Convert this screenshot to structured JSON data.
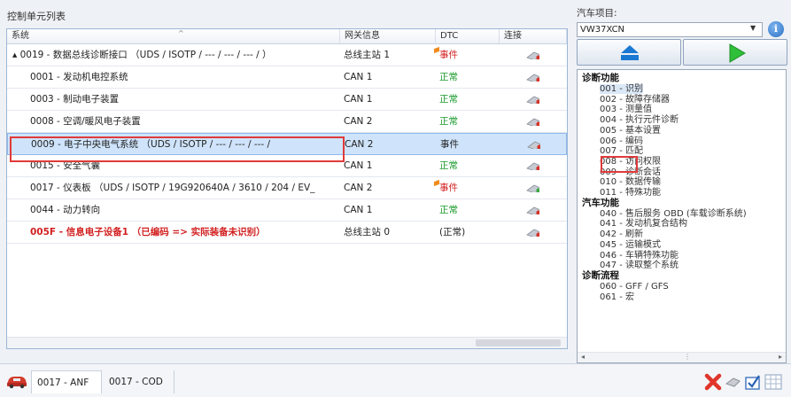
{
  "left_panel": {
    "title": "控制单元列表"
  },
  "table": {
    "headers": [
      "系统",
      "网关信息",
      "DTC",
      "连接"
    ],
    "rows": [
      {
        "system": "▴ 0019 - 数据总线诊断接口 （UDS / ISOTP / --- / --- / --- / ）",
        "gateway": "总线主站 1",
        "dtc": "事件",
        "dtc_style": "red",
        "conn_icon": "plug-icon"
      },
      {
        "system": "0001 - 发动机电控系统",
        "gateway": "CAN 1",
        "dtc": "正常",
        "dtc_style": "green",
        "conn_icon": "plug-icon"
      },
      {
        "system": "0003 - 制动电子装置",
        "gateway": "CAN 1",
        "dtc": "正常",
        "dtc_style": "green",
        "conn_icon": "plug-icon"
      },
      {
        "system": "0008 - 空调/暖风电子装置",
        "gateway": "CAN 2",
        "dtc": "正常",
        "dtc_style": "green",
        "conn_icon": "plug-icon"
      },
      {
        "system": "0009 - 电子中央电气系统 （UDS / ISOTP / --- / --- / --- /",
        "gateway": "CAN 2",
        "dtc": "事件",
        "dtc_style": "normal",
        "conn_icon": "plug-icon",
        "selected": true
      },
      {
        "system": "0015 - 安全气囊",
        "gateway": "CAN 1",
        "dtc": "正常",
        "dtc_style": "green",
        "conn_icon": "plug-icon"
      },
      {
        "system": "0017 - 仪表板 （UDS / ISOTP / 19G920640A / 3610 / 204 / EV_",
        "gateway": "CAN 2",
        "dtc": "事件",
        "dtc_style": "red",
        "conn_icon": "plug-green-icon"
      },
      {
        "system": "0044 - 动力转向",
        "gateway": "CAN 1",
        "dtc": "正常",
        "dtc_style": "green",
        "conn_icon": "plug-icon"
      },
      {
        "system": "005F - 信息电子设备1 （已编码 => 实际装备未识别）",
        "gateway": "总线主站 0",
        "dtc": "(正常)",
        "dtc_style": "normal",
        "conn_icon": "plug-icon",
        "system_style": "red-bold"
      }
    ]
  },
  "right_panel": {
    "vehicle_label": "汽车项目:",
    "vehicle_value": "VW37XCN",
    "colors": {
      "up_button": "#1b78d2",
      "play_button": "#2fbf3a"
    },
    "tree": [
      {
        "label": "诊断功能",
        "type": "cat"
      },
      {
        "label": "001 - 识别",
        "type": "item"
      },
      {
        "label": "002 - 故障存储器",
        "type": "item"
      },
      {
        "label": "003 - 测量值",
        "type": "item"
      },
      {
        "label": "004 - 执行元件诊断",
        "type": "item"
      },
      {
        "label": "005 - 基本设置",
        "type": "item"
      },
      {
        "label": "006 - 编码",
        "type": "item"
      },
      {
        "label": "007 - 匹配",
        "type": "item"
      },
      {
        "label": "008 - 访问权限",
        "type": "item"
      },
      {
        "label": "009 - 诊断会话",
        "type": "item"
      },
      {
        "label": "010 - 数据传输",
        "type": "item"
      },
      {
        "label": "011 - 特殊功能",
        "type": "item"
      },
      {
        "label": "汽车功能",
        "type": "cat"
      },
      {
        "label": "040 - 售后服务 OBD (车载诊断系统)",
        "type": "item"
      },
      {
        "label": "041 - 发动机复合结构",
        "type": "item"
      },
      {
        "label": "042 - 刷新",
        "type": "item"
      },
      {
        "label": "045 - 运输模式",
        "type": "item"
      },
      {
        "label": "046 - 车辆特殊功能",
        "type": "item"
      },
      {
        "label": "047 - 读取整个系统",
        "type": "item"
      },
      {
        "label": "诊断流程",
        "type": "cat"
      },
      {
        "label": "060 - GFF / GFS",
        "type": "item"
      },
      {
        "label": "061 - 宏",
        "type": "item"
      }
    ]
  },
  "bottom_bar": {
    "tabs": [
      {
        "label": "0017 - ANF"
      },
      {
        "label": "0017 - COD"
      }
    ]
  }
}
